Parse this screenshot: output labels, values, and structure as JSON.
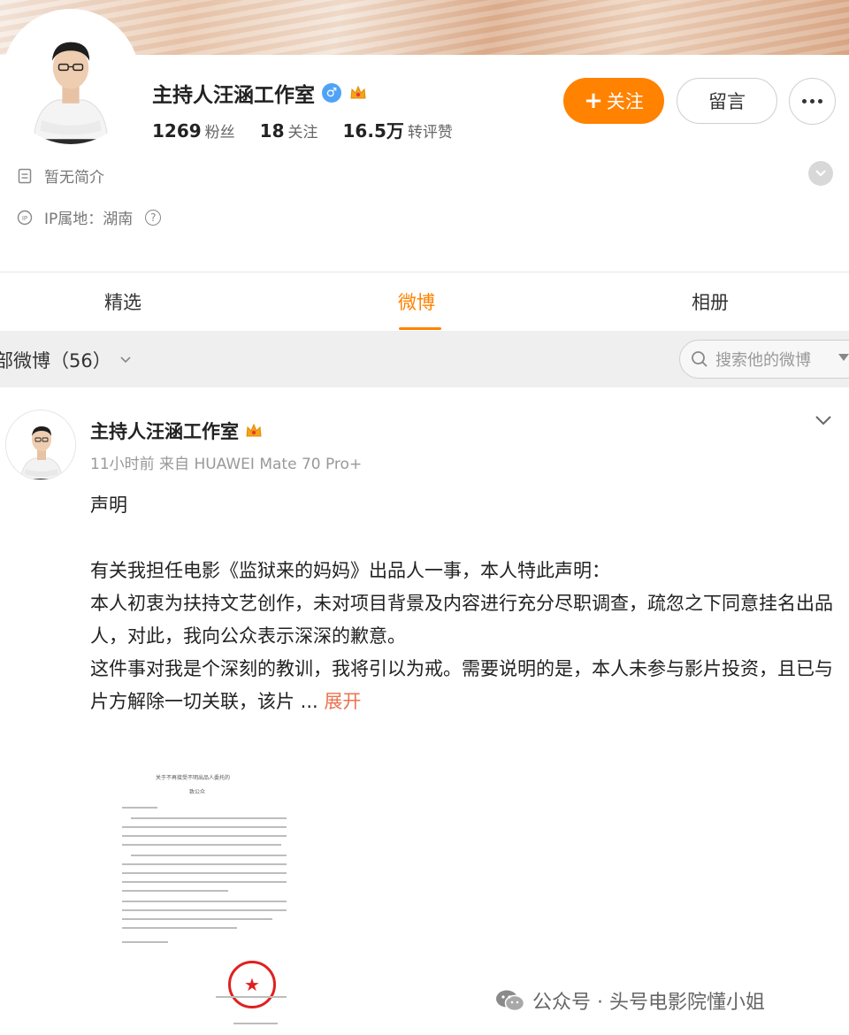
{
  "profile": {
    "name": "主持人汪涵工作室",
    "gender_symbol": "♂",
    "stats": [
      {
        "value": "1269",
        "label": "粉丝"
      },
      {
        "value": "18",
        "label": "关注"
      },
      {
        "value": "16.5万",
        "label": "转评赞"
      }
    ],
    "follow_label": "关注",
    "message_label": "留言",
    "bio": "暂无简介",
    "ip_location": "IP属地：湖南"
  },
  "tabs": [
    "精选",
    "微博",
    "相册"
  ],
  "active_tab": "微博",
  "filter": {
    "label": "部微博（56）",
    "search_placeholder": "搜索他的微博"
  },
  "post": {
    "author": "主持人汪涵工作室",
    "meta": "11小时前 来自 HUAWEI Mate 70 Pro+",
    "title": "声明",
    "line1": "有关我担任电影《监狱来的妈妈》出品人一事，本人特此声明：",
    "line2": "本人初衷为扶持文艺创作，未对项目背景及内容进行充分尽职调查，疏忽之下同意挂名出品人，对此，我向公众表示深深的歉意。",
    "line3_prefix": "这件事对我是个深刻的教训，我将引以为戒。需要说明的是，本人未参与影片投资，且已与片方解除一切关联，该片",
    "ellipsis": " ...",
    "expand_label": "展开"
  },
  "document_image": {
    "title": "关于不再接受不明出品人委托的",
    "subtitle": "致公众"
  },
  "watermark": "公众号 · 头号电影院懂小姐",
  "colors": {
    "accent": "#ff8200",
    "link": "#eb7350",
    "seal": "#e02020"
  }
}
